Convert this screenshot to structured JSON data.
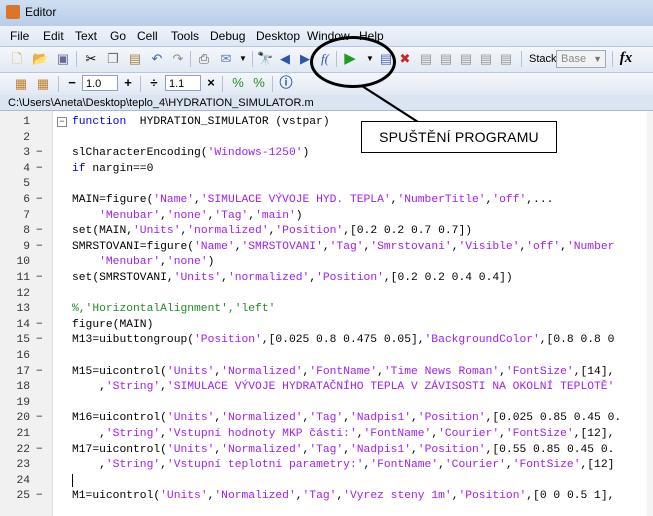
{
  "window": {
    "title": "Editor"
  },
  "menu": [
    "File",
    "Edit",
    "Text",
    "Go",
    "Cell",
    "Tools",
    "Debug",
    "Desktop",
    "Window",
    "Help"
  ],
  "toolbar": {
    "icons": [
      "new-file",
      "open-folder",
      "save",
      "cut",
      "copy",
      "paste",
      "undo",
      "redo",
      "print",
      "email",
      "dropdown",
      "find",
      "back",
      "forward",
      "function-browser",
      "run",
      "run-dropdown",
      "set-breakpoint",
      "clear-breakpoint",
      "step",
      "step-in",
      "step-out",
      "continue",
      "exit-debug"
    ],
    "stack_label": "Stack:",
    "stack_value": "Base",
    "fx_label": "fx"
  },
  "cellbar": {
    "minus": "−",
    "value1": "1.0",
    "plus": "+",
    "divide": "÷",
    "value2": "1.1",
    "times": "×"
  },
  "path": "C:\\Users\\Aneta\\Desktop\\teplo_4\\HYDRATION_SIMULATOR.m",
  "callout": "SPUŠTĚNÍ PROGRAMU",
  "code_lines": [
    {
      "n": "1",
      "dash": "",
      "segments": [
        [
          "kw",
          "function"
        ],
        [
          "",
          "  HYDRATION_SIMULATOR (vstpar)"
        ]
      ]
    },
    {
      "n": "2",
      "dash": "",
      "segments": []
    },
    {
      "n": "3",
      "dash": "−",
      "segments": [
        [
          "",
          "slCharacterEncoding("
        ],
        [
          "str",
          "'Windows-1250'"
        ],
        [
          "",
          ")"
        ]
      ]
    },
    {
      "n": "4",
      "dash": "−",
      "segments": [
        [
          "kw",
          "if"
        ],
        [
          "",
          " nargin==0"
        ]
      ]
    },
    {
      "n": "5",
      "dash": "",
      "segments": []
    },
    {
      "n": "6",
      "dash": "−",
      "segments": [
        [
          "",
          "MAIN=figure("
        ],
        [
          "str",
          "'Name'"
        ],
        [
          "",
          ","
        ],
        [
          "str",
          "'SIMULACE VÝVOJE HYD. TEPLA'"
        ],
        [
          "",
          ","
        ],
        [
          "str",
          "'NumberTitle'"
        ],
        [
          "",
          ","
        ],
        [
          "str",
          "'off'"
        ],
        [
          "",
          ",..."
        ]
      ]
    },
    {
      "n": "7",
      "dash": "",
      "segments": [
        [
          "",
          "    "
        ],
        [
          "str",
          "'Menubar'"
        ],
        [
          "",
          ","
        ],
        [
          "str",
          "'none'"
        ],
        [
          "",
          ","
        ],
        [
          "str",
          "'Tag'"
        ],
        [
          "",
          ","
        ],
        [
          "str",
          "'main'"
        ],
        [
          "",
          ")"
        ]
      ]
    },
    {
      "n": "8",
      "dash": "−",
      "segments": [
        [
          "",
          "set(MAIN,"
        ],
        [
          "str",
          "'Units'"
        ],
        [
          "",
          ","
        ],
        [
          "str",
          "'normalized'"
        ],
        [
          "",
          ","
        ],
        [
          "str",
          "'Position'"
        ],
        [
          "",
          ",[0.2 0.2 0.7 0.7])"
        ]
      ]
    },
    {
      "n": "9",
      "dash": "−",
      "segments": [
        [
          "",
          "SMRSTOVANI=figure("
        ],
        [
          "str",
          "'Name'"
        ],
        [
          "",
          ","
        ],
        [
          "str",
          "'SMRSTOVANI'"
        ],
        [
          "",
          ","
        ],
        [
          "str",
          "'Tag'"
        ],
        [
          "",
          ","
        ],
        [
          "str",
          "'Smrstovani'"
        ],
        [
          "",
          ","
        ],
        [
          "str",
          "'Visible'"
        ],
        [
          "",
          ","
        ],
        [
          "str",
          "'off'"
        ],
        [
          "",
          ","
        ],
        [
          "str",
          "'Number"
        ]
      ]
    },
    {
      "n": "10",
      "dash": "",
      "segments": [
        [
          "",
          "    "
        ],
        [
          "str",
          "'Menubar'"
        ],
        [
          "",
          ","
        ],
        [
          "str",
          "'none'"
        ],
        [
          "",
          ")"
        ]
      ]
    },
    {
      "n": "11",
      "dash": "−",
      "segments": [
        [
          "",
          "set(SMRSTOVANI,"
        ],
        [
          "str",
          "'Units'"
        ],
        [
          "",
          ","
        ],
        [
          "str",
          "'normalized'"
        ],
        [
          "",
          ","
        ],
        [
          "str",
          "'Position'"
        ],
        [
          "",
          ",[0.2 0.2 0.4 0.4])"
        ]
      ]
    },
    {
      "n": "12",
      "dash": "",
      "segments": []
    },
    {
      "n": "13",
      "dash": "",
      "segments": [
        [
          "cm",
          "%,'HorizontalAlignment','left'"
        ]
      ]
    },
    {
      "n": "14",
      "dash": "−",
      "segments": [
        [
          "",
          "figure(MAIN)"
        ]
      ]
    },
    {
      "n": "15",
      "dash": "−",
      "segments": [
        [
          "",
          "M13=uibuttongroup("
        ],
        [
          "str",
          "'Position'"
        ],
        [
          "",
          ",[0.025 0.8 0.475 0.05],"
        ],
        [
          "str",
          "'BackgroundColor'"
        ],
        [
          "",
          ",[0.8 0.8 0"
        ]
      ]
    },
    {
      "n": "16",
      "dash": "",
      "segments": []
    },
    {
      "n": "17",
      "dash": "−",
      "segments": [
        [
          "",
          "M15=uicontrol("
        ],
        [
          "str",
          "'Units'"
        ],
        [
          "",
          ","
        ],
        [
          "str",
          "'Normalized'"
        ],
        [
          "",
          ","
        ],
        [
          "str",
          "'FontName'"
        ],
        [
          "",
          ","
        ],
        [
          "str",
          "'Time News Roman'"
        ],
        [
          "",
          ","
        ],
        [
          "str",
          "'FontSize'"
        ],
        [
          "",
          ",[14],"
        ]
      ]
    },
    {
      "n": "18",
      "dash": "",
      "segments": [
        [
          "",
          "    ,"
        ],
        [
          "str",
          "'String'"
        ],
        [
          "",
          ","
        ],
        [
          "str",
          "'SIMULACE VÝVOJE HYDRATAČNÍHO TEPLA V ZÁVISOSTI NA OKOLNÍ TEPLOTĚ'"
        ]
      ]
    },
    {
      "n": "19",
      "dash": "",
      "segments": []
    },
    {
      "n": "20",
      "dash": "−",
      "segments": [
        [
          "",
          "M16=uicontrol("
        ],
        [
          "str",
          "'Units'"
        ],
        [
          "",
          ","
        ],
        [
          "str",
          "'Normalized'"
        ],
        [
          "",
          ","
        ],
        [
          "str",
          "'Tag'"
        ],
        [
          "",
          ","
        ],
        [
          "str",
          "'Nadpis1'"
        ],
        [
          "",
          ","
        ],
        [
          "str",
          "'Position'"
        ],
        [
          "",
          ",[0.025 0.85 0.45 0."
        ]
      ]
    },
    {
      "n": "21",
      "dash": "",
      "segments": [
        [
          "",
          "    ,"
        ],
        [
          "str",
          "'String'"
        ],
        [
          "",
          ","
        ],
        [
          "str",
          "'Vstupní hodnoty MKP části:'"
        ],
        [
          "",
          ","
        ],
        [
          "str",
          "'FontName'"
        ],
        [
          "",
          ","
        ],
        [
          "str",
          "'Courier'"
        ],
        [
          "",
          ","
        ],
        [
          "str",
          "'FontSize'"
        ],
        [
          "",
          ",[12],"
        ]
      ]
    },
    {
      "n": "22",
      "dash": "−",
      "segments": [
        [
          "",
          "M17=uicontrol("
        ],
        [
          "str",
          "'Units'"
        ],
        [
          "",
          ","
        ],
        [
          "str",
          "'Normalized'"
        ],
        [
          "",
          ","
        ],
        [
          "str",
          "'Tag'"
        ],
        [
          "",
          ","
        ],
        [
          "str",
          "'Nadpis1'"
        ],
        [
          "",
          ","
        ],
        [
          "str",
          "'Position'"
        ],
        [
          "",
          ",[0.55 0.85 0.45 0."
        ]
      ]
    },
    {
      "n": "23",
      "dash": "",
      "segments": [
        [
          "",
          "    ,"
        ],
        [
          "str",
          "'String'"
        ],
        [
          "",
          ","
        ],
        [
          "str",
          "'Vstupní teplotní parametry:'"
        ],
        [
          "",
          ","
        ],
        [
          "str",
          "'FontName'"
        ],
        [
          "",
          ","
        ],
        [
          "str",
          "'Courier'"
        ],
        [
          "",
          ","
        ],
        [
          "str",
          "'FontSize'"
        ],
        [
          "",
          ",[12]"
        ]
      ]
    },
    {
      "n": "24",
      "dash": "",
      "segments": []
    },
    {
      "n": "25",
      "dash": "−",
      "segments": [
        [
          "",
          "M1=uicontrol("
        ],
        [
          "str",
          "'Units'"
        ],
        [
          "",
          ","
        ],
        [
          "str",
          "'Normalized'"
        ],
        [
          "",
          ","
        ],
        [
          "str",
          "'Tag'"
        ],
        [
          "",
          ","
        ],
        [
          "str",
          "'Vyrez steny 1m'"
        ],
        [
          "",
          ","
        ],
        [
          "str",
          "'Position'"
        ],
        [
          "",
          ",[0 0 0.5 1],"
        ]
      ]
    }
  ],
  "colors": {
    "keyword": "#0000ff",
    "string": "#a020f0",
    "comment": "#228b22",
    "run": "#1f9d22"
  }
}
